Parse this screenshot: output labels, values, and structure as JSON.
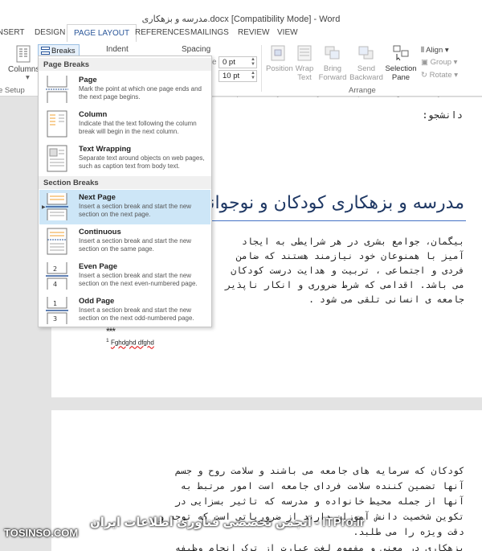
{
  "window": {
    "title": "مدرسه و بزهکاری.docx [Compatibility Mode] - Word"
  },
  "tabs": [
    {
      "label": "INSERT"
    },
    {
      "label": "DESIGN"
    },
    {
      "label": "PAGE LAYOUT"
    },
    {
      "label": "REFERENCES"
    },
    {
      "label": "MAILINGS"
    },
    {
      "label": "REVIEW"
    },
    {
      "label": "VIEW"
    }
  ],
  "ribbon": {
    "columns_label": "Columns",
    "page_setup_label": "e Setup",
    "breaks_label": "Breaks",
    "indent_label": "Indent",
    "spacing_label": "Spacing",
    "spacing_before": "0 pt",
    "spacing_after": "10 pt",
    "position_label": "Position",
    "wrap_text_label": "Wrap\nText",
    "bring_forward_label": "Bring\nForward",
    "send_backward_label": "Send\nBackward",
    "selection_pane_label": "Selection\nPane",
    "align_label": "Align",
    "group_label": "Group",
    "rotate_label": "Rotate",
    "arrange_label": "Arrange"
  },
  "breaks_menu": {
    "page_breaks_header": "Page Breaks",
    "section_breaks_header": "Section Breaks",
    "items": [
      {
        "name": "Page",
        "desc": "Mark the point at which one page ends and the next page begins."
      },
      {
        "name": "Column",
        "desc": "Indicate that the text following the column break will begin in the next column."
      },
      {
        "name": "Text Wrapping",
        "desc": "Separate text around objects on web pages, such as caption text from body text."
      },
      {
        "name": "Next Page",
        "desc": "Insert a section break and start the new section on the next page."
      },
      {
        "name": "Continuous",
        "desc": "Insert a section break and start the new section on the same page."
      },
      {
        "name": "Even Page",
        "desc": "Insert a section break and start the new section on the next even-numbered page."
      },
      {
        "name": "Odd Page",
        "desc": "Insert a section break and start the new section on the next odd-numbered page."
      }
    ]
  },
  "document": {
    "student_label": "دانشجو:",
    "heading": "مدرسه و بزهکاری کودکان و نوجوانان",
    "page1_lines": [
      "بیگمان، جوامع بشری در هر شرایطی به ایجاد",
      "آمیز با همنوعان خود نیازمند هستند که ضامن",
      "فردی و اجتماعی ، تربیت و هدایت درست کودکان",
      "می باشد. اقدامی که شرط ضروری و انکار ناپذیر",
      "جامعه ی انسانی تلقی می شود ."
    ],
    "stars": "***",
    "footnote_num": "1",
    "footnote_text": "Fghdghd dfghd",
    "page2_lines": [
      "کودکان که سرمایه های جامعه می باشند و سلامت روح و جسم",
      "آنها تضمین کننده سلامت فردای جامعه است امور مرتبط به",
      "آنها از جمله محیط خانواده و مدرسه که تاثیر بسزایی در",
      "تکوین شخصیت دانش آموزان دارند از ضروریاتی است که توجه و",
      "دقت ویژه را می طلبد.",
      "بزهکاری در معنی و مفهوم لغت عبارت از ترک انجام وظیفه"
    ]
  },
  "watermark": {
    "site": "TOSINSO.COM",
    "tagline": "ITPro.ir - انجمن تخصصی فناوری اطلاعات ایران"
  },
  "colors": {
    "accent": "#2b579a",
    "highlight": "#cde6f7",
    "heading": "#1f3864"
  }
}
